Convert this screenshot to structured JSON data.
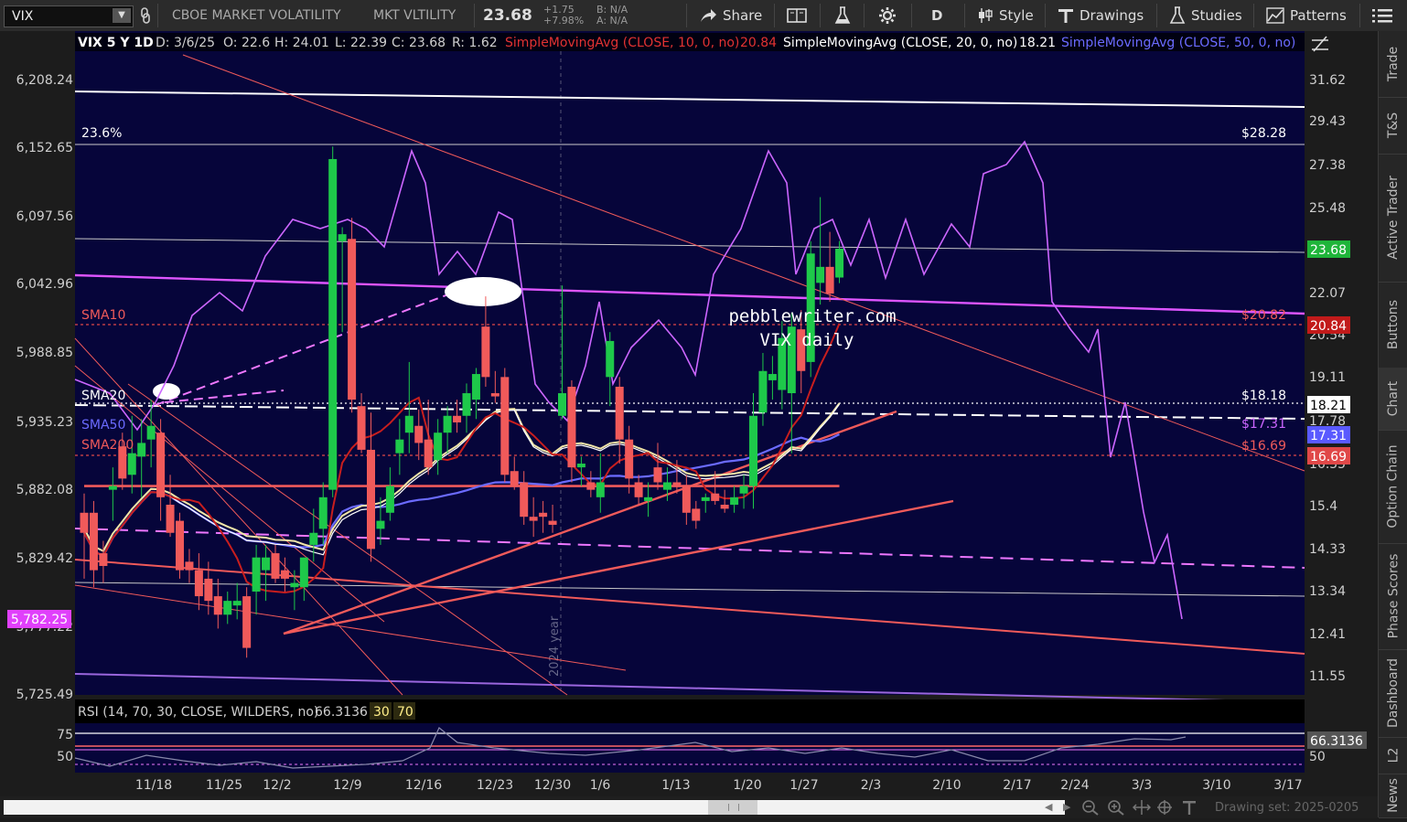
{
  "toolbar": {
    "symbol": "VIX",
    "company": "CBOE MARKET VOLATILITY",
    "exchange": "MKT VLTILITY",
    "last": "23.68",
    "change": "+1.75",
    "change_pct": "+7.98%",
    "bid": "B: N/A",
    "ask": "A: N/A",
    "share": "Share",
    "aggregation": "D",
    "style": "Style",
    "drawings": "Drawings",
    "studies": "Studies",
    "patterns": "Patterns"
  },
  "header": {
    "title": "VIX 5 Y 1D",
    "date": "D: 3/6/25",
    "open": "O: 22.6",
    "high": "H: 24.01",
    "low": "L: 22.39",
    "close": "C: 23.68",
    "range": "R: 1.62",
    "sma10_label": "SimpleMovingAvg (CLOSE, 10, 0, no)",
    "sma10_val": "20.84",
    "sma20_label": "SimpleMovingAvg (CLOSE, 20, 0, no)",
    "sma20_val": "18.21",
    "sma50_label": "SimpleMovingAvg (CLOSE, 50, 0, no)"
  },
  "annotations": {
    "site": "pebblewriter.com",
    "subtitle": "VIX daily",
    "fib_pct": "23.6%",
    "fib_price": "$28.28",
    "sma10": "SMA10",
    "sma20": "SMA20",
    "sma50": "SMA50",
    "sma200": "SMA200",
    "sma10_price": "$20.82",
    "sma20_price": "$18.18",
    "sma50_price": "$17.31",
    "sma200_price": "$16.69",
    "year_marker": "2024 year"
  },
  "left_axis": [
    "6,208.24",
    "6,152.65",
    "6,097.56",
    "6,042.96",
    "5,988.85",
    "5,935.23",
    "5,882.08",
    "5,829.42",
    "5,777.22",
    "5,725.49"
  ],
  "left_marker": "5,782.25",
  "right_axis": [
    "31.62",
    "29.43",
    "27.38",
    "25.48",
    "23.68",
    "22.07",
    "20.84",
    "20.54",
    "19.11",
    "18.21",
    "17.78",
    "17.31",
    "16.69",
    "16.55",
    "15.4",
    "14.33",
    "13.34",
    "12.41",
    "11.55"
  ],
  "price_tags": {
    "last": "23.68",
    "sma10": "20.84",
    "sma20": "18.21",
    "sma50": "17.31",
    "sma200": "16.69"
  },
  "rsi": {
    "label": "RSI (14, 70, 30, CLOSE, WILDERS, no)",
    "value": "66.3136",
    "ob": "30",
    "os": "70",
    "axis_hi": "75",
    "axis_lo": "50"
  },
  "x_axis": [
    "11/18",
    "11/25",
    "12/2",
    "12/9",
    "12/16",
    "12/23",
    "12/30",
    "1/6",
    "1/13",
    "1/20",
    "1/27",
    "2/3",
    "2/10",
    "2/17",
    "2/24",
    "3/3",
    "3/10",
    "3/17"
  ],
  "right_tabs": [
    "Trade",
    "T&S",
    "Active Trader",
    "Buttons",
    "Chart",
    "Option Chain",
    "Phase Scores",
    "Dashboard",
    "L2",
    "News"
  ],
  "drawing_set": "Drawing set: 2025-0205",
  "colors": {
    "chart_bg": "#06053a",
    "up": "#1ec94a",
    "down": "#f05a5a",
    "sma10": "#c81e1e",
    "sma20": "#ffffff",
    "sma50": "#6b6bff",
    "sma200": "#f05a5a",
    "spx": "#cc66ff"
  },
  "chart_data": {
    "type": "candlestick",
    "title": "VIX 5 Y 1D",
    "yrange": [
      11.0,
      33.0
    ],
    "candles": [
      {
        "o": 15.2,
        "h": 15.7,
        "l": 13.6,
        "c": 14.7
      },
      {
        "o": 15.2,
        "h": 15.5,
        "l": 13.4,
        "c": 13.8
      },
      {
        "o": 14.2,
        "h": 14.5,
        "l": 13.5,
        "c": 13.9
      },
      {
        "o": 15.8,
        "h": 16.4,
        "l": 15.0,
        "c": 15.9
      },
      {
        "o": 17.0,
        "h": 17.4,
        "l": 15.8,
        "c": 16.1
      },
      {
        "o": 16.2,
        "h": 17.9,
        "l": 15.7,
        "c": 16.8
      },
      {
        "o": 16.7,
        "h": 17.8,
        "l": 15.6,
        "c": 17.1
      },
      {
        "o": 17.2,
        "h": 18.4,
        "l": 16.4,
        "c": 17.6
      },
      {
        "o": 17.4,
        "h": 17.8,
        "l": 15.0,
        "c": 15.6
      },
      {
        "o": 15.4,
        "h": 16.2,
        "l": 14.6,
        "c": 14.7
      },
      {
        "o": 15.0,
        "h": 15.2,
        "l": 13.6,
        "c": 13.8
      },
      {
        "o": 14.0,
        "h": 14.3,
        "l": 13.5,
        "c": 13.8
      },
      {
        "o": 13.8,
        "h": 14.2,
        "l": 12.9,
        "c": 13.2
      },
      {
        "o": 13.6,
        "h": 14.0,
        "l": 12.8,
        "c": 13.1
      },
      {
        "o": 13.2,
        "h": 13.6,
        "l": 12.5,
        "c": 12.8
      },
      {
        "o": 12.8,
        "h": 13.3,
        "l": 12.6,
        "c": 13.1
      },
      {
        "o": 13.0,
        "h": 13.5,
        "l": 12.7,
        "c": 13.1
      },
      {
        "o": 13.2,
        "h": 13.4,
        "l": 11.9,
        "c": 12.1
      },
      {
        "o": 13.3,
        "h": 14.4,
        "l": 12.8,
        "c": 14.1
      },
      {
        "o": 13.8,
        "h": 14.4,
        "l": 13.1,
        "c": 14.1
      },
      {
        "o": 14.2,
        "h": 14.4,
        "l": 13.5,
        "c": 13.6
      },
      {
        "o": 13.8,
        "h": 14.1,
        "l": 13.3,
        "c": 13.6
      },
      {
        "o": 13.4,
        "h": 13.8,
        "l": 12.9,
        "c": 13.5
      },
      {
        "o": 13.4,
        "h": 14.1,
        "l": 13.1,
        "c": 14.1
      },
      {
        "o": 14.4,
        "h": 15.3,
        "l": 14.0,
        "c": 14.7
      },
      {
        "o": 14.8,
        "h": 16.0,
        "l": 14.4,
        "c": 15.6
      },
      {
        "o": 15.8,
        "h": 28.2,
        "l": 15.6,
        "c": 27.6
      },
      {
        "o": 24.0,
        "h": 24.6,
        "l": 20.6,
        "c": 24.3
      },
      {
        "o": 24.1,
        "h": 25.0,
        "l": 18.0,
        "c": 18.4
      },
      {
        "o": 18.2,
        "h": 18.6,
        "l": 16.8,
        "c": 16.9
      },
      {
        "o": 16.9,
        "h": 18.0,
        "l": 14.0,
        "c": 14.3
      },
      {
        "o": 14.8,
        "h": 15.6,
        "l": 14.4,
        "c": 15.0
      },
      {
        "o": 15.2,
        "h": 16.4,
        "l": 15.0,
        "c": 15.9
      },
      {
        "o": 16.8,
        "h": 17.8,
        "l": 16.2,
        "c": 17.2
      },
      {
        "o": 17.4,
        "h": 19.6,
        "l": 16.8,
        "c": 17.9
      },
      {
        "o": 17.6,
        "h": 18.1,
        "l": 16.6,
        "c": 17.1
      },
      {
        "o": 17.2,
        "h": 18.4,
        "l": 16.2,
        "c": 16.4
      },
      {
        "o": 16.6,
        "h": 17.8,
        "l": 16.2,
        "c": 17.4
      },
      {
        "o": 17.4,
        "h": 18.2,
        "l": 16.8,
        "c": 17.9
      },
      {
        "o": 17.9,
        "h": 18.4,
        "l": 17.4,
        "c": 17.7
      },
      {
        "o": 17.9,
        "h": 18.9,
        "l": 17.4,
        "c": 18.6
      },
      {
        "o": 18.4,
        "h": 19.4,
        "l": 17.8,
        "c": 19.2
      },
      {
        "o": 20.8,
        "h": 21.9,
        "l": 18.8,
        "c": 19.1
      },
      {
        "o": 18.6,
        "h": 19.3,
        "l": 18.3,
        "c": 18.5
      },
      {
        "o": 19.1,
        "h": 19.4,
        "l": 16.0,
        "c": 16.2
      },
      {
        "o": 16.3,
        "h": 16.7,
        "l": 15.8,
        "c": 15.9
      },
      {
        "o": 16.0,
        "h": 16.3,
        "l": 14.9,
        "c": 15.1
      },
      {
        "o": 15.1,
        "h": 15.6,
        "l": 14.6,
        "c": 15.0
      },
      {
        "o": 15.2,
        "h": 15.5,
        "l": 14.7,
        "c": 15.1
      },
      {
        "o": 15.0,
        "h": 15.4,
        "l": 14.7,
        "c": 14.9
      },
      {
        "o": 17.9,
        "h": 22.3,
        "l": 17.8,
        "c": 18.6
      },
      {
        "o": 18.8,
        "h": 19.0,
        "l": 16.0,
        "c": 16.4
      },
      {
        "o": 16.4,
        "h": 16.7,
        "l": 15.9,
        "c": 16.5
      },
      {
        "o": 16.0,
        "h": 16.3,
        "l": 15.6,
        "c": 15.8
      },
      {
        "o": 15.6,
        "h": 16.8,
        "l": 15.2,
        "c": 16.0
      },
      {
        "o": 19.1,
        "h": 20.6,
        "l": 18.2,
        "c": 20.3
      },
      {
        "o": 18.8,
        "h": 19.1,
        "l": 16.5,
        "c": 17.2
      },
      {
        "o": 17.2,
        "h": 17.6,
        "l": 15.7,
        "c": 16.1
      },
      {
        "o": 16.0,
        "h": 16.2,
        "l": 15.4,
        "c": 15.6
      },
      {
        "o": 15.5,
        "h": 16.0,
        "l": 15.1,
        "c": 15.6
      },
      {
        "o": 16.4,
        "h": 17.1,
        "l": 15.8,
        "c": 16.0
      },
      {
        "o": 15.8,
        "h": 16.4,
        "l": 15.5,
        "c": 16.0
      },
      {
        "o": 16.0,
        "h": 16.6,
        "l": 15.7,
        "c": 15.9
      },
      {
        "o": 15.9,
        "h": 16.2,
        "l": 14.9,
        "c": 15.2
      },
      {
        "o": 15.3,
        "h": 15.5,
        "l": 14.8,
        "c": 15.0
      },
      {
        "o": 15.5,
        "h": 15.7,
        "l": 15.2,
        "c": 15.6
      },
      {
        "o": 15.7,
        "h": 16.3,
        "l": 15.4,
        "c": 15.5
      },
      {
        "o": 15.4,
        "h": 15.8,
        "l": 15.2,
        "c": 15.3
      },
      {
        "o": 15.4,
        "h": 15.9,
        "l": 15.2,
        "c": 15.6
      },
      {
        "o": 15.7,
        "h": 16.2,
        "l": 15.3,
        "c": 15.9
      },
      {
        "o": 15.9,
        "h": 18.6,
        "l": 15.3,
        "c": 17.9
      },
      {
        "o": 18.0,
        "h": 19.9,
        "l": 17.6,
        "c": 19.3
      },
      {
        "o": 19.0,
        "h": 19.8,
        "l": 18.4,
        "c": 19.2
      },
      {
        "o": 18.7,
        "h": 21.0,
        "l": 18.1,
        "c": 20.4
      },
      {
        "o": 18.6,
        "h": 21.3,
        "l": 16.8,
        "c": 20.8
      },
      {
        "o": 20.7,
        "h": 21.4,
        "l": 18.6,
        "c": 19.3
      },
      {
        "o": 19.6,
        "h": 24.0,
        "l": 19.1,
        "c": 23.5
      },
      {
        "o": 22.4,
        "h": 25.9,
        "l": 21.6,
        "c": 23.0
      },
      {
        "o": 23.0,
        "h": 24.4,
        "l": 21.7,
        "c": 22.0
      },
      {
        "o": 22.6,
        "h": 24.01,
        "l": 22.39,
        "c": 23.68
      }
    ]
  }
}
